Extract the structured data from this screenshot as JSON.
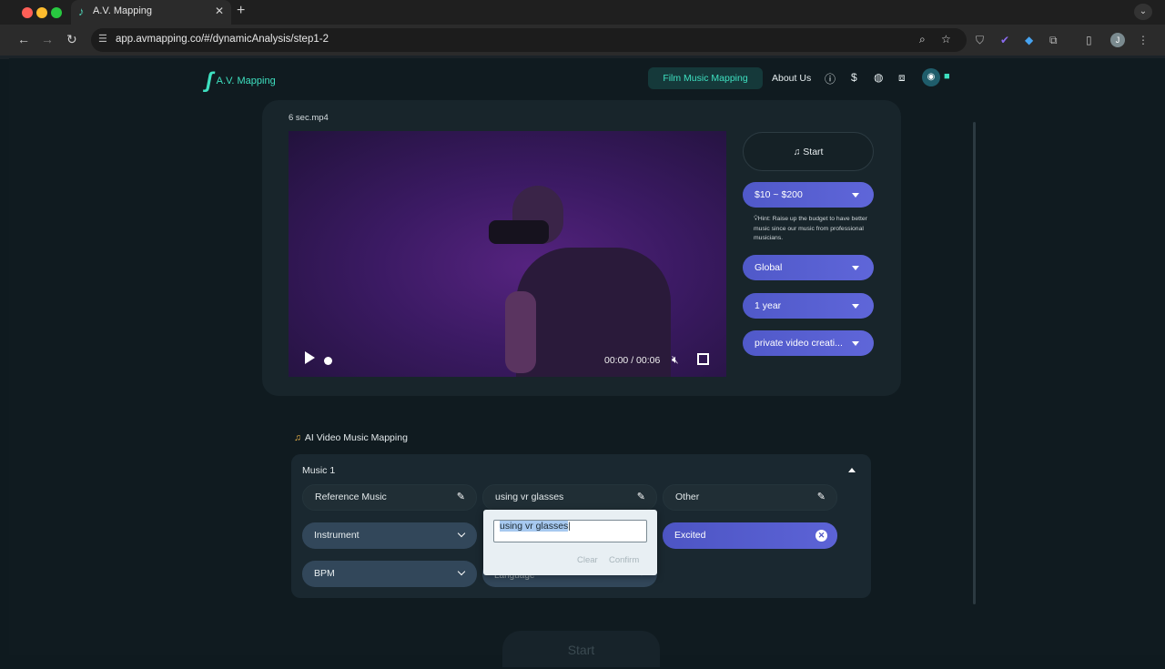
{
  "browser": {
    "tab_title": "A.V. Mapping",
    "url": "app.avmapping.co/#/dynamicAnalysis/step1-2",
    "avatar_initial": "J"
  },
  "nav": {
    "logo_text": "A.V. Mapping",
    "active_item": "Film Music Mapping",
    "about": "About Us",
    "dollar_icon": "$"
  },
  "video": {
    "filename": "6 sec.mp4",
    "timecode": "00:00 / 00:06"
  },
  "side_controls": {
    "start_label": "Start",
    "budget": "$10 ~ $200",
    "hint": "Hint: Raise up the budget to have better music since our music from professional musicians.",
    "region": "Global",
    "duration": "1 year",
    "usage": "private video creati..."
  },
  "mapping": {
    "section_title": "AI Video Music Mapping",
    "music_title": "Music 1",
    "fields": [
      "Reference Music",
      "using vr glasses",
      "Other"
    ],
    "selects": [
      "Instrument",
      "BPM"
    ],
    "mood_tag": "Excited",
    "language_placeholder": "Language"
  },
  "popover": {
    "input_value": "using vr glasses",
    "clear": "Clear",
    "confirm": "Confirm"
  },
  "bottom": {
    "start_label": "Start"
  },
  "colors": {
    "accent": "#3ee0c0",
    "dropdown": "#5059c9",
    "background": "#101b20"
  }
}
